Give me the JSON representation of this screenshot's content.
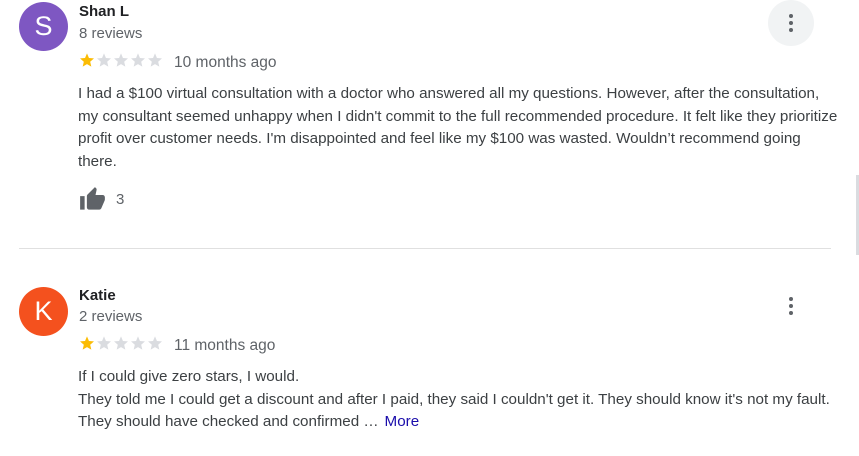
{
  "reviews": [
    {
      "avatar_letter": "S",
      "avatar_color": "#7e57c2",
      "author": "Shan L",
      "reviews_count": "8 reviews",
      "rating": 1,
      "time": "10 months ago",
      "text": "I had a $100 virtual consultation with a doctor who answered all my questions. However, after the consultation, my consultant seemed unhappy when I didn't commit to the full recommended procedure. It felt like they prioritize profit over customer needs. I'm disappointed and feel like my $100 was wasted. Wouldn’t recommend going there.",
      "likes": "3"
    },
    {
      "avatar_letter": "K",
      "avatar_color": "#f4511e",
      "author": "Katie",
      "reviews_count": "2 reviews",
      "rating": 1,
      "time": "11 months ago",
      "text_line1": "If I could give zero stars, I would.",
      "text_line2": "They told me I could get a discount and after I paid, they said I couldn't get it. They should know it's not my fault. They should have checked and confirmed …",
      "more_label": "More"
    }
  ],
  "colors": {
    "star_filled": "#fbbc04",
    "star_empty": "#dadce0",
    "thumb": "#5f6368"
  },
  "icons": {
    "star": "star-icon",
    "menu": "more-vert-icon",
    "like": "thumb-up-icon"
  }
}
